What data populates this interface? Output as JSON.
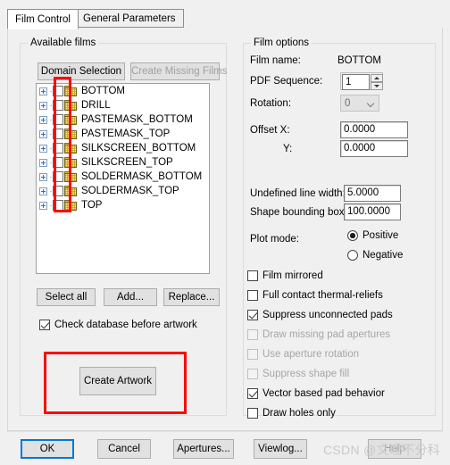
{
  "window": {
    "tabs": [
      {
        "label": "Film Control",
        "active": true
      },
      {
        "label": "General Parameters",
        "active": false
      }
    ]
  },
  "available_films": {
    "legend": "Available films",
    "buttons": {
      "domain_selection": "Domain Selection",
      "create_missing_films": "Create Missing Films",
      "select_all": "Select all",
      "add": "Add...",
      "replace": "Replace...",
      "create_artwork": "Create Artwork"
    },
    "tree": [
      {
        "label": "BOTTOM",
        "checked": false
      },
      {
        "label": "DRILL",
        "checked": false
      },
      {
        "label": "PASTEMASK_BOTTOM",
        "checked": false
      },
      {
        "label": "PASTEMASK_TOP",
        "checked": false
      },
      {
        "label": "SILKSCREEN_BOTTOM",
        "checked": false
      },
      {
        "label": "SILKSCREEN_TOP",
        "checked": false
      },
      {
        "label": "SOLDERMASK_BOTTOM",
        "checked": false
      },
      {
        "label": "SOLDERMASK_TOP",
        "checked": false
      },
      {
        "label": "TOP",
        "checked": false
      }
    ],
    "check_database": {
      "label": "Check database before artwork",
      "checked": true
    }
  },
  "film_options": {
    "legend": "Film options",
    "film_name_label": "Film name:",
    "film_name_value": "BOTTOM",
    "pdf_sequence_label": "PDF Sequence:",
    "pdf_sequence_value": "1",
    "rotation_label": "Rotation:",
    "rotation_value": "0",
    "offset_x_label": "Offset  X:",
    "offset_x_value": "0.0000",
    "offset_y_label": "Y:",
    "offset_y_value": "0.0000",
    "undefined_line_width_label": "Undefined line width:",
    "undefined_line_width_value": "5.0000",
    "shape_bounding_box_label": "Shape bounding box:",
    "shape_bounding_box_value": "100.0000",
    "plot_mode_label": "Plot mode:",
    "plot_mode_options": [
      {
        "label": "Positive",
        "selected": true
      },
      {
        "label": "Negative",
        "selected": false
      }
    ],
    "checkboxes": [
      {
        "label": "Film mirrored",
        "checked": false,
        "enabled": true
      },
      {
        "label": "Full contact thermal-reliefs",
        "checked": false,
        "enabled": true
      },
      {
        "label": "Suppress unconnected pads",
        "checked": true,
        "enabled": true
      },
      {
        "label": "Draw missing pad apertures",
        "checked": false,
        "enabled": false
      },
      {
        "label": "Use aperture rotation",
        "checked": false,
        "enabled": false
      },
      {
        "label": "Suppress shape fill",
        "checked": false,
        "enabled": false
      },
      {
        "label": "Vector based pad behavior",
        "checked": true,
        "enabled": true
      },
      {
        "label": "Draw holes only",
        "checked": false,
        "enabled": true
      }
    ]
  },
  "footer": {
    "ok": "OK",
    "cancel": "Cancel",
    "apertures": "Apertures...",
    "viewlog": "Viewlog...",
    "help": "Help"
  },
  "watermark": "CSDN @文理不分科",
  "accent_colors": {
    "annotation_red": "#fb0909",
    "default_button_blue": "#0078d7",
    "folder_yellow": "#ffe98a"
  }
}
